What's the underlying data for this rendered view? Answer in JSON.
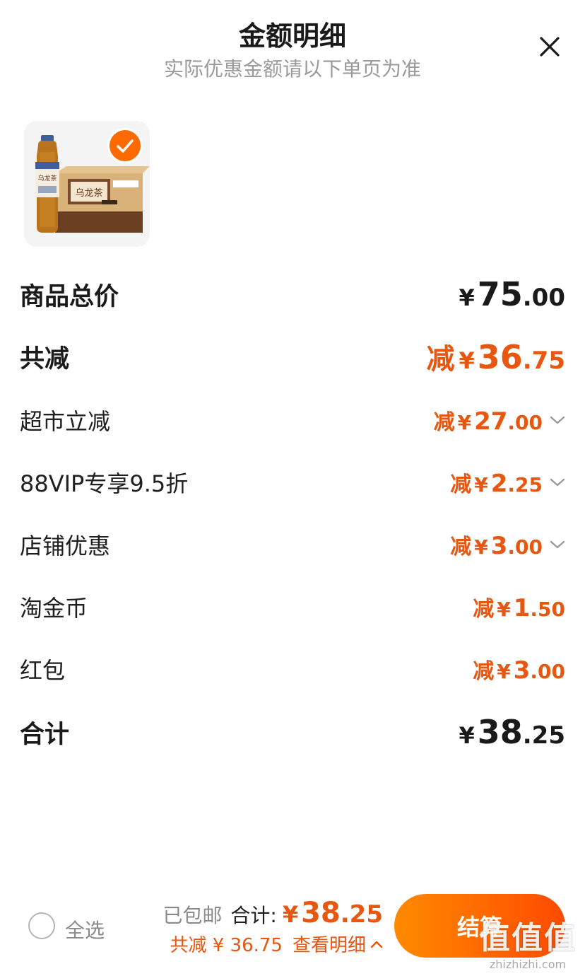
{
  "header": {
    "title": "金额明细",
    "subtitle": "实际优惠金额请以下单页为准"
  },
  "product": {
    "bottle_label": "乌龙茶",
    "box_label": "乌龙茶"
  },
  "rows": [
    {
      "label": "商品总价",
      "prefix": "",
      "symbol": "¥",
      "int": "75",
      "dec": ".00",
      "style": "total"
    },
    {
      "label": "共减",
      "prefix": "减",
      "symbol": "¥",
      "int": "36",
      "dec": ".75",
      "style": "discount-total"
    },
    {
      "label": "超市立减",
      "prefix": "减",
      "symbol": "¥",
      "int": "27",
      "dec": ".00",
      "expandable": true
    },
    {
      "label": "88VIP专享9.5折",
      "prefix": "减",
      "symbol": "¥",
      "int": "2",
      "dec": ".25",
      "expandable": true
    },
    {
      "label": "店铺优惠",
      "prefix": "减",
      "symbol": "¥",
      "int": "3",
      "dec": ".00",
      "expandable": true
    },
    {
      "label": "淘金币",
      "prefix": "减",
      "symbol": "¥",
      "int": "1",
      "dec": ".50",
      "expandable": false
    },
    {
      "label": "红包",
      "prefix": "减",
      "symbol": "¥",
      "int": "3",
      "dec": ".00",
      "expandable": false
    },
    {
      "label": "合计",
      "prefix": "",
      "symbol": "¥",
      "int": "38",
      "dec": ".25",
      "style": "total"
    }
  ],
  "footer": {
    "select_all": "全选",
    "free_shipping": "已包邮",
    "total_label": "合计:",
    "total_symbol": "¥",
    "total_int": "38",
    "total_dec": ".25",
    "discount_text": "共减 ¥ 36.75",
    "detail_link": "查看明细",
    "checkout": "结算"
  },
  "watermark": {
    "big": "值值值",
    "small": "zhizhizhi.com"
  },
  "colors": {
    "accent": "#e8560f",
    "button_start": "#ff8a00",
    "button_end": "#ff4a00"
  }
}
